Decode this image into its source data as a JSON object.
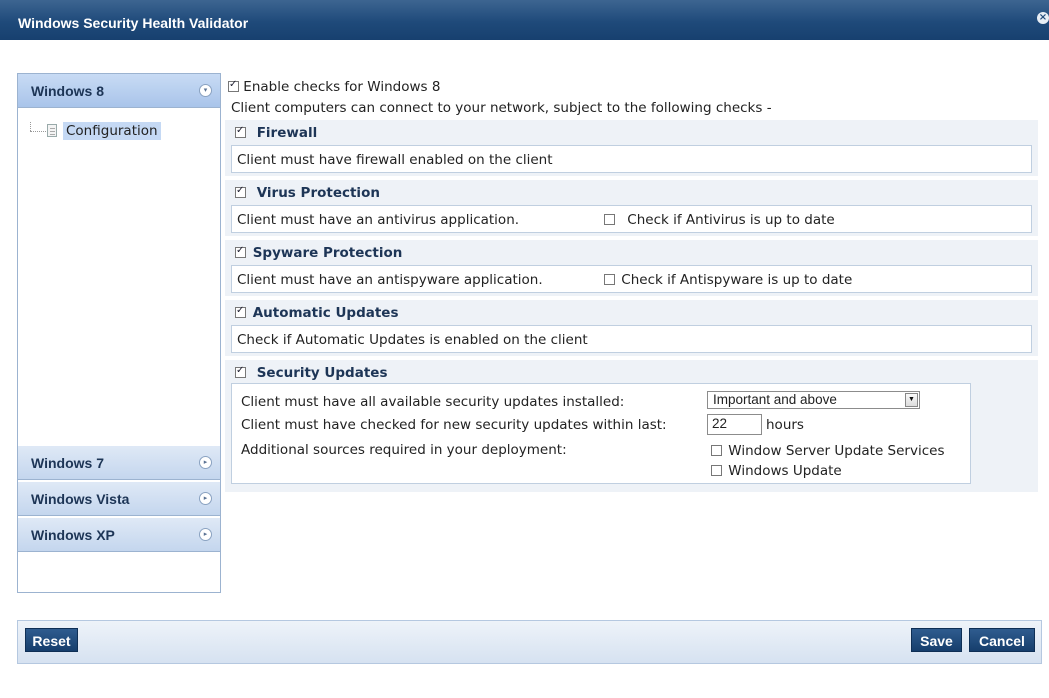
{
  "window": {
    "title": "Windows Security Health Validator",
    "close_glyph": "×"
  },
  "sidebar": {
    "items": [
      {
        "label": "Windows 8",
        "active": true
      },
      {
        "label": "Windows 7"
      },
      {
        "label": "Windows Vista"
      },
      {
        "label": "Windows XP"
      }
    ],
    "tree": {
      "child": "Configuration"
    },
    "chevron_glyph": "▸"
  },
  "main": {
    "enable_label": "Enable checks for Windows 8",
    "intro": "Client computers can connect to your network, subject to the following checks -",
    "firewall": {
      "title": "Firewall",
      "text": "Client must have firewall enabled on the client",
      "checked": true
    },
    "virus": {
      "title": "Virus Protection",
      "text": "Client must have an antivirus application.",
      "uptodate": "Check if Antivirus is up to date",
      "checked": true
    },
    "spyware": {
      "title": "Spyware Protection",
      "text": "Client must have an antispyware application.",
      "uptodate": "Check if Antispyware is up to date",
      "checked": true
    },
    "autoupdates": {
      "title": "Automatic Updates",
      "text": "Check if Automatic Updates is enabled on the client",
      "checked": true
    },
    "security": {
      "title": "Security Updates",
      "checked": true,
      "installed_label": "Client must have all available security updates installed:",
      "severity_value": "Important and above",
      "checked_label": "Client must have checked for new security updates within last:",
      "hours_value": "22",
      "hours_unit": "hours",
      "sources_label": "Additional sources required in your deployment:",
      "source_wsus": "Window Server Update Services",
      "source_wu": "Windows Update"
    }
  },
  "footer": {
    "reset": "Reset",
    "save": "Save",
    "cancel": "Cancel"
  },
  "colors": {
    "accent": "#1f4a7a",
    "button": "#163e6c"
  }
}
